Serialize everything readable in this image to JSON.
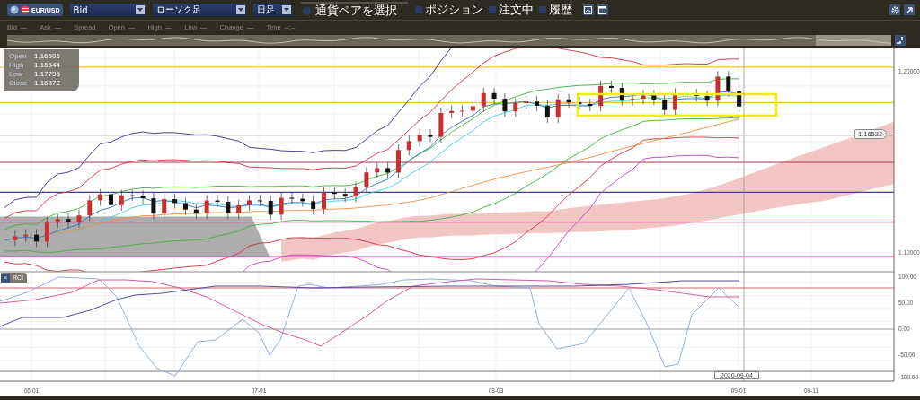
{
  "toolbar": {
    "symbol": "EUR/USD",
    "selects": [
      {
        "value": "Bid"
      },
      {
        "value": "ローソク足"
      },
      {
        "value": "日足"
      }
    ],
    "pair_picker": {
      "label": "通貨ペアを選択",
      "selected": false
    },
    "checkboxes": [
      {
        "label": "ポジション",
        "checked": false
      },
      {
        "label": "注文中",
        "checked": false
      },
      {
        "label": "履歴",
        "checked": false
      }
    ]
  },
  "quote_bar": [
    {
      "label": "Bid",
      "value": "—"
    },
    {
      "label": "Ask",
      "value": "—"
    },
    {
      "label": "Spread"
    },
    {
      "label": "Open",
      "value": "—"
    },
    {
      "label": "High",
      "value": "—"
    },
    {
      "label": "Low",
      "value": "—"
    },
    {
      "label": "Change",
      "value": "—"
    },
    {
      "label": "Time",
      "value": "--:--"
    }
  ],
  "ohlc_tooltip": [
    {
      "label": "Open",
      "value": "1.16506"
    },
    {
      "label": "High",
      "value": "1.16644"
    },
    {
      "label": "Low",
      "value": "1.17795"
    },
    {
      "label": "Close",
      "value": "1.16372"
    }
  ],
  "price_axis": [
    "1.20000",
    "1.10000"
  ],
  "price_marker": "1.16532",
  "indicator": {
    "name": "RCI",
    "close": "×"
  },
  "rci_axis": [
    "100.00",
    "50.00",
    "0.00",
    "-50.00",
    "-100.00"
  ],
  "date_axis": [
    "06-01",
    "07-01",
    "08-03",
    "09-01",
    "09-11"
  ],
  "cursor_date": "2020-09-04"
}
